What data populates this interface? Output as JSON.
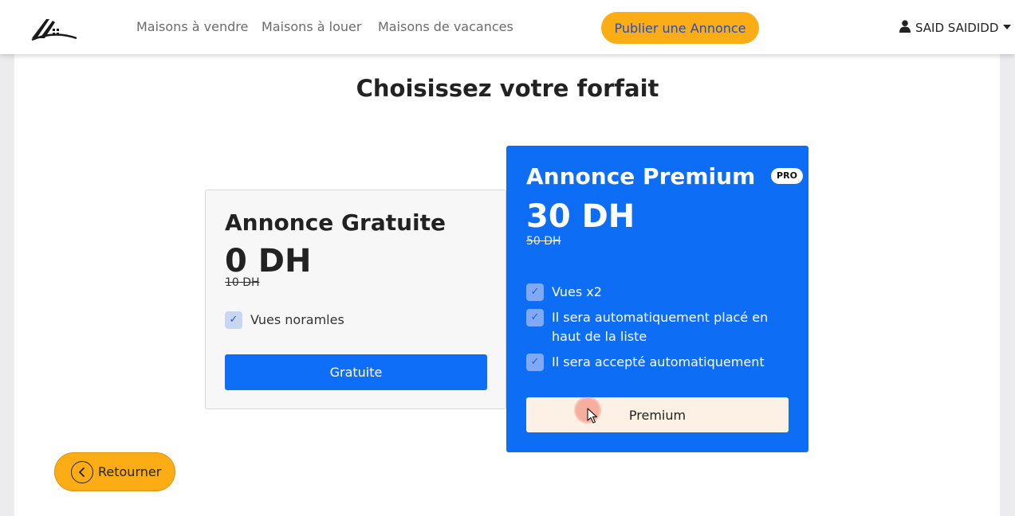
{
  "header": {
    "nav": [
      {
        "label": "Maisons à vendre"
      },
      {
        "label": "Maisons à louer"
      },
      {
        "label": "Maisons de vacances"
      }
    ],
    "publish_label": "Publier une Annonce",
    "user_name": "SAID SAIDIDD"
  },
  "main": {
    "title": "Choisissez votre forfait",
    "plans": {
      "free": {
        "name": "Annonce Gratuite",
        "price": "0 DH",
        "old_price": "10 DH",
        "features": [
          "Vues noramles"
        ],
        "button_label": "Gratuite"
      },
      "premium": {
        "name": "Annonce Premium",
        "badge": "PRO",
        "price": "30 DH",
        "old_price": "50 DH",
        "features": [
          "Vues x2",
          "Il sera automatiquement placé en haut de la liste",
          "Il sera accepté automatiquement"
        ],
        "button_label": "Premium"
      }
    },
    "back_label": "Retourner"
  },
  "colors": {
    "accent_orange": "#fcac14",
    "primary_blue": "#0d6df5",
    "publish_text": "#1d4fcf"
  },
  "icons": {
    "logo": "house-roof-logo",
    "user": "user-icon",
    "caret": "caret-down-icon",
    "check": "check-icon",
    "back": "chevron-left-circle-icon",
    "cursor": "mouse-pointer-icon"
  }
}
